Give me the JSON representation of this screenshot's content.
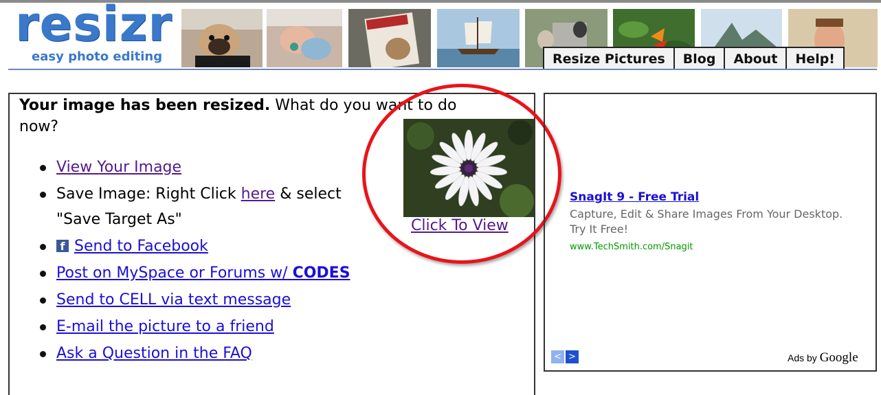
{
  "logo": {
    "wordmark": "resizr",
    "tagline": "easy photo editing"
  },
  "header": {
    "thumbnails": [
      {
        "icon": "pug-photo"
      },
      {
        "icon": "baby-photo"
      },
      {
        "icon": "magazine-dog-photo"
      },
      {
        "icon": "sailing-ship-photo"
      },
      {
        "icon": "pugs-walking-photo"
      },
      {
        "icon": "tropical-flower-photo"
      },
      {
        "icon": "island-mountain-photo"
      },
      {
        "icon": "man-portrait-photo"
      }
    ],
    "nav": [
      {
        "label": "Resize Pictures"
      },
      {
        "label": "Blog"
      },
      {
        "label": "About"
      },
      {
        "label": "Help!"
      }
    ]
  },
  "main": {
    "intro_bold": "Your image has been resized.",
    "intro_rest": " What do you want to do now?",
    "options": {
      "view_image": "View Your Image",
      "save_prefix": "Save Image: Right Click ",
      "save_link": "here",
      "save_suffix": " & select",
      "save_line2": "\"Save Target As\"",
      "facebook_icon_glyph": "f",
      "facebook": "Send to Facebook",
      "myspace_prefix": "Post on MySpace or Forums w/ ",
      "myspace_bold": "CODES",
      "cell": "Send to CELL via text message",
      "email": "E-mail the picture to a friend",
      "faq": "Ask a Question in the FAQ"
    },
    "preview": {
      "link": "Click To View"
    }
  },
  "ad": {
    "title": "SnagIt 9 - Free Trial",
    "description": "Capture, Edit & Share Images From Your Desktop. Try It Free!",
    "url": "www.TechSmith.com/Snagit",
    "prev_glyph": "<",
    "next_glyph": ">",
    "ads_by": "Ads by",
    "google": "Google"
  },
  "colors": {
    "accent_red": "#e8141a",
    "link": "#1a0fd6",
    "visited": "#551a8b",
    "logo_blue": "#3a78c9",
    "ad_green": "#009a00"
  }
}
